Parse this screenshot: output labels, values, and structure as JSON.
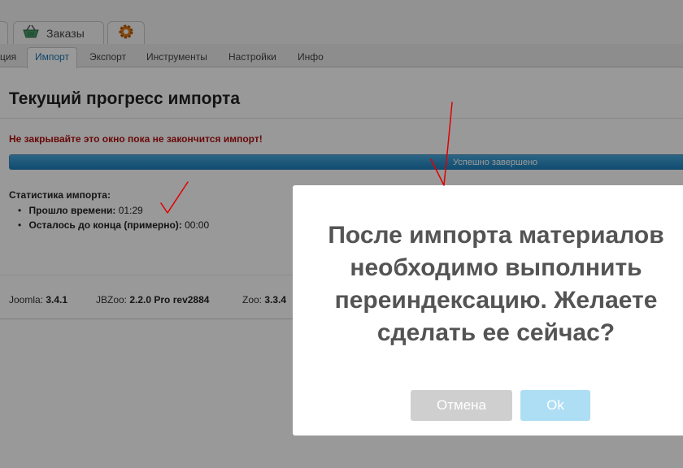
{
  "top_tabs": [
    {
      "label": ""
    },
    {
      "label": "Заказы",
      "icon": "basket-icon"
    },
    {
      "label": "",
      "icon": "gear-icon"
    }
  ],
  "subnav": [
    "ция",
    "Импорт",
    "Экспорт",
    "Инструменты",
    "Настройки",
    "Инфо"
  ],
  "page_title": "Текущий прогресс импорта",
  "warning": "Не закрывайте это окно пока не закончится импорт!",
  "progress": {
    "label": "Успешно завершено",
    "percent": 100
  },
  "stats": {
    "title": "Статистика импорта:",
    "elapsed_label": "Прошло времени:",
    "elapsed_value": "01:29",
    "remaining_label": "Осталось до конца (примерно):",
    "remaining_value": "00:00"
  },
  "versions": [
    {
      "name": "Joomla:",
      "value": "3.4.1"
    },
    {
      "name": "JBZoo:",
      "value": "2.2.0 Pro rev2884"
    },
    {
      "name": "Zoo:",
      "value": "3.3.4"
    }
  ],
  "modal": {
    "message": "После импорта материалов необходимо выполнить переиндексацию. Желаете сделать ее сейчас?",
    "cancel_label": "Отмена",
    "ok_label": "Ok"
  },
  "colors": {
    "warning": "#b01010",
    "progress": "#1b7fbd",
    "annotation": "#e00000"
  }
}
